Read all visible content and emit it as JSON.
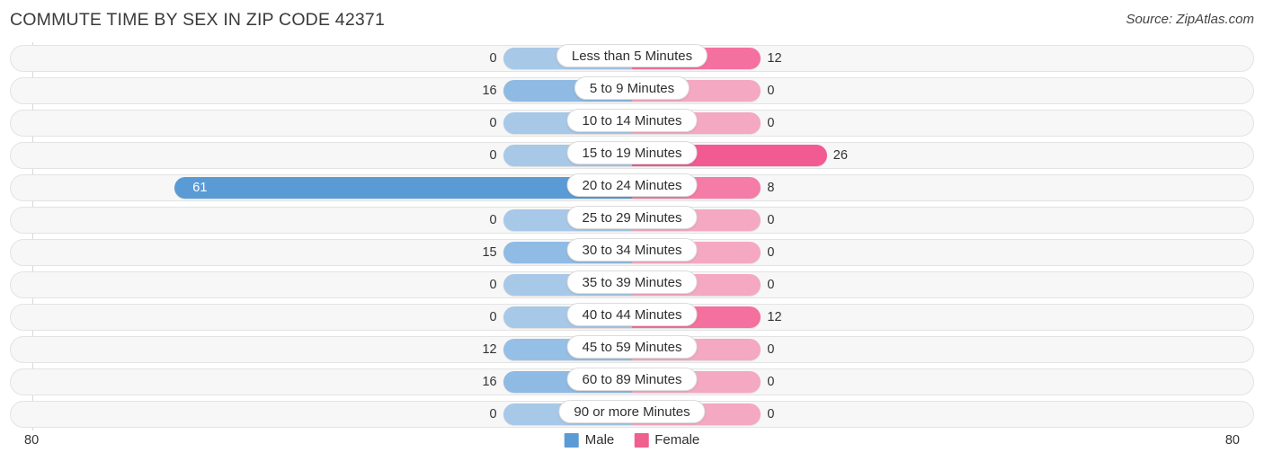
{
  "header": {
    "title": "COMMUTE TIME BY SEX IN ZIP CODE 42371",
    "source": "Source: ZipAtlas.com"
  },
  "legend": {
    "male_label": "Male",
    "female_label": "Female",
    "male_color": "#5b9bd5",
    "female_color": "#f0608f"
  },
  "axis": {
    "min_label": "80",
    "max_label": "80"
  },
  "colors": {
    "male_strong": "#5b9bd5",
    "male_light": "#a8c8e8",
    "female_strong": "#f2629a",
    "female_mid": "#f47ca6",
    "female_light": "#f5afc6"
  },
  "chart_data": {
    "type": "bar",
    "title": "COMMUTE TIME BY SEX IN ZIP CODE 42371",
    "subtitle": "Source: ZipAtlas.com",
    "orientation": "horizontal",
    "style": "diverging-bidirectional",
    "xlabel": "",
    "ylabel": "",
    "xlim": [
      80,
      80
    ],
    "axis_max": 80,
    "grid": false,
    "legend_position": "bottom-center",
    "categories": [
      "Less than 5 Minutes",
      "5 to 9 Minutes",
      "10 to 14 Minutes",
      "15 to 19 Minutes",
      "20 to 24 Minutes",
      "25 to 29 Minutes",
      "30 to 34 Minutes",
      "35 to 39 Minutes",
      "40 to 44 Minutes",
      "45 to 59 Minutes",
      "60 to 89 Minutes",
      "90 or more Minutes"
    ],
    "series": [
      {
        "name": "Male",
        "side": "left",
        "color": "#5b9bd5",
        "values": [
          0,
          16,
          0,
          0,
          61,
          0,
          15,
          0,
          0,
          12,
          16,
          0
        ]
      },
      {
        "name": "Female",
        "side": "right",
        "color": "#f0608f",
        "values": [
          12,
          0,
          0,
          26,
          8,
          0,
          0,
          0,
          12,
          0,
          0,
          0
        ]
      }
    ]
  },
  "rows": [
    {
      "label": "Less than 5 Minutes",
      "male": {
        "value": "0",
        "num": 0,
        "fill": "#a8c8e8",
        "inside": false
      },
      "female": {
        "value": "12",
        "num": 12,
        "fill": "#f4719f",
        "inside": false
      }
    },
    {
      "label": "5 to 9 Minutes",
      "male": {
        "value": "16",
        "num": 16,
        "fill": "#8fbae3",
        "inside": false
      },
      "female": {
        "value": "0",
        "num": 0,
        "fill": "#f5a8c2",
        "inside": false
      }
    },
    {
      "label": "10 to 14 Minutes",
      "male": {
        "value": "0",
        "num": 0,
        "fill": "#a8c8e8",
        "inside": false
      },
      "female": {
        "value": "0",
        "num": 0,
        "fill": "#f5a8c2",
        "inside": false
      }
    },
    {
      "label": "15 to 19 Minutes",
      "male": {
        "value": "0",
        "num": 0,
        "fill": "#a8c8e8",
        "inside": false
      },
      "female": {
        "value": "26",
        "num": 26,
        "fill": "#f25a92",
        "inside": false
      }
    },
    {
      "label": "20 to 24 Minutes",
      "male": {
        "value": "61",
        "num": 61,
        "fill": "#5b9bd5",
        "inside": true
      },
      "female": {
        "value": "8",
        "num": 8,
        "fill": "#f47ca6",
        "inside": false
      }
    },
    {
      "label": "25 to 29 Minutes",
      "male": {
        "value": "0",
        "num": 0,
        "fill": "#a8c8e8",
        "inside": false
      },
      "female": {
        "value": "0",
        "num": 0,
        "fill": "#f5a8c2",
        "inside": false
      }
    },
    {
      "label": "30 to 34 Minutes",
      "male": {
        "value": "15",
        "num": 15,
        "fill": "#90bbe4",
        "inside": false
      },
      "female": {
        "value": "0",
        "num": 0,
        "fill": "#f5a8c2",
        "inside": false
      }
    },
    {
      "label": "35 to 39 Minutes",
      "male": {
        "value": "0",
        "num": 0,
        "fill": "#a8c8e8",
        "inside": false
      },
      "female": {
        "value": "0",
        "num": 0,
        "fill": "#f5a8c2",
        "inside": false
      }
    },
    {
      "label": "40 to 44 Minutes",
      "male": {
        "value": "0",
        "num": 0,
        "fill": "#a8c8e8",
        "inside": false
      },
      "female": {
        "value": "12",
        "num": 12,
        "fill": "#f4719f",
        "inside": false
      }
    },
    {
      "label": "45 to 59 Minutes",
      "male": {
        "value": "12",
        "num": 12,
        "fill": "#96bfe6",
        "inside": false
      },
      "female": {
        "value": "0",
        "num": 0,
        "fill": "#f5a8c2",
        "inside": false
      }
    },
    {
      "label": "60 to 89 Minutes",
      "male": {
        "value": "16",
        "num": 16,
        "fill": "#8fbae3",
        "inside": false
      },
      "female": {
        "value": "0",
        "num": 0,
        "fill": "#f5a8c2",
        "inside": false
      }
    },
    {
      "label": "90 or more Minutes",
      "male": {
        "value": "0",
        "num": 0,
        "fill": "#a8c8e8",
        "inside": false
      },
      "female": {
        "value": "0",
        "num": 0,
        "fill": "#f5a8c2",
        "inside": false
      }
    }
  ]
}
